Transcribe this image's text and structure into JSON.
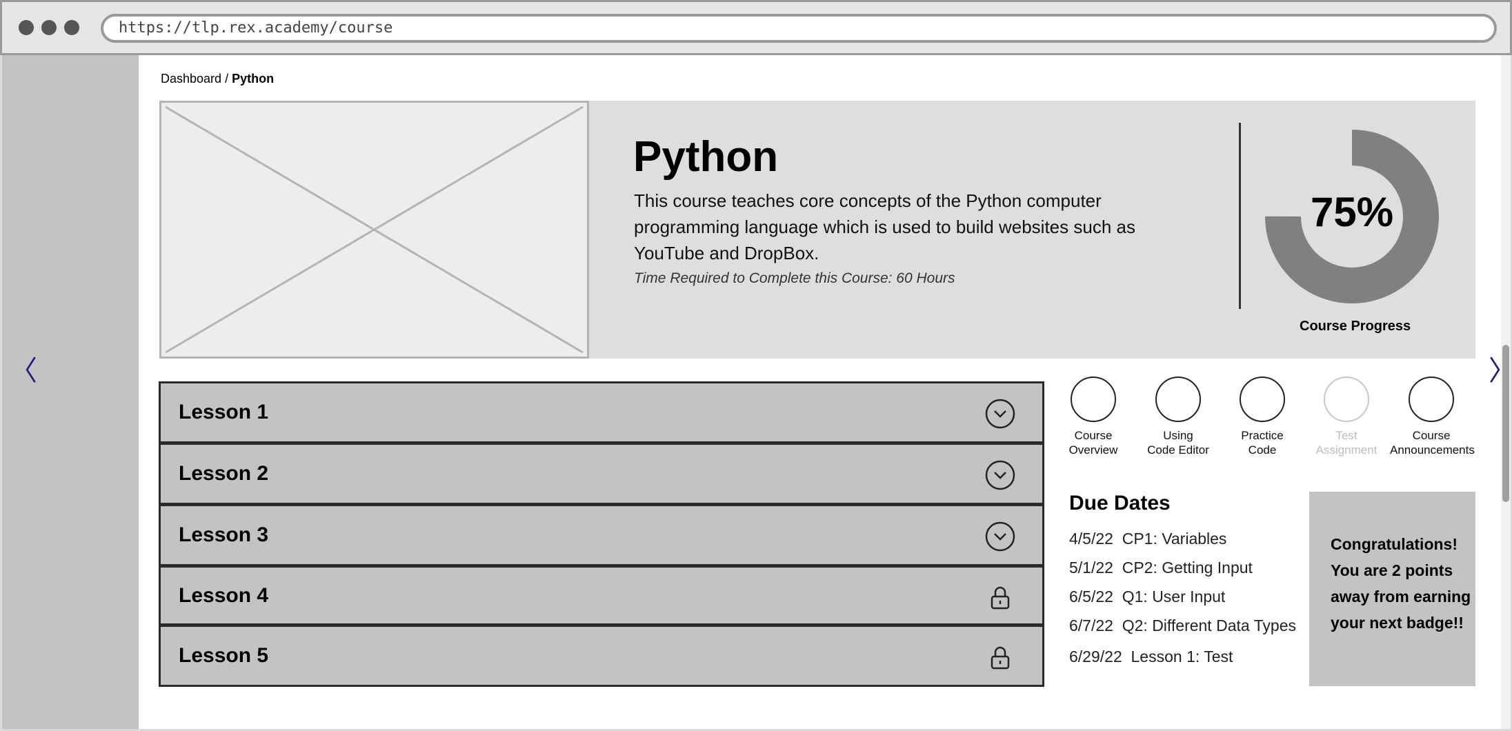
{
  "browser": {
    "url": "https://tlp.rex.academy/course"
  },
  "nav": {
    "prev_icon": "chevron-left-icon",
    "next_icon": "chevron-right-icon"
  },
  "breadcrumb": {
    "parent": "Dashboard",
    "separator": "/",
    "current": "Python"
  },
  "course": {
    "title": "Python",
    "description": "This course teaches core concepts of the Python computer programming language which is used to build websites such as YouTube and DropBox.",
    "time_required": "Time Required to Complete this Course: 60 Hours",
    "progress_percent": 75,
    "progress_label": "75%",
    "progress_caption": "Course Progress"
  },
  "lessons": [
    {
      "label": "Lesson 1",
      "icon": "chevron-down-icon"
    },
    {
      "label": "Lesson 2",
      "icon": "chevron-down-icon"
    },
    {
      "label": "Lesson 3",
      "icon": "chevron-down-icon"
    },
    {
      "label": "Lesson 4",
      "icon": "lock-icon"
    },
    {
      "label": "Lesson 5",
      "icon": "lock-icon"
    }
  ],
  "quick_links": [
    {
      "line1": "Course",
      "line2": "Overview",
      "enabled": true
    },
    {
      "line1": "Using",
      "line2": "Code Editor",
      "enabled": true
    },
    {
      "line1": "Practice",
      "line2": "Code",
      "enabled": true
    },
    {
      "line1": "Test",
      "line2": "Assignment",
      "enabled": false
    },
    {
      "line1": "Course",
      "line2": "Announcements",
      "enabled": true
    }
  ],
  "due_dates": {
    "title": "Due Dates",
    "items": [
      "4/5/22  CP1: Variables",
      "5/1/22  CP2: Getting Input",
      "6/5/22  Q1: User Input",
      "6/7/22  Q2: Different Data Types",
      "6/29/22  Lesson 1: Test"
    ]
  },
  "congrats": {
    "lines": [
      "Congratulations!",
      "You are 2 points",
      "away from earning",
      "your next badge!!"
    ]
  },
  "colors": {
    "progress_fill": "#808080",
    "progress_track": "#dedede",
    "panel_gray": "#c3c3c3"
  }
}
